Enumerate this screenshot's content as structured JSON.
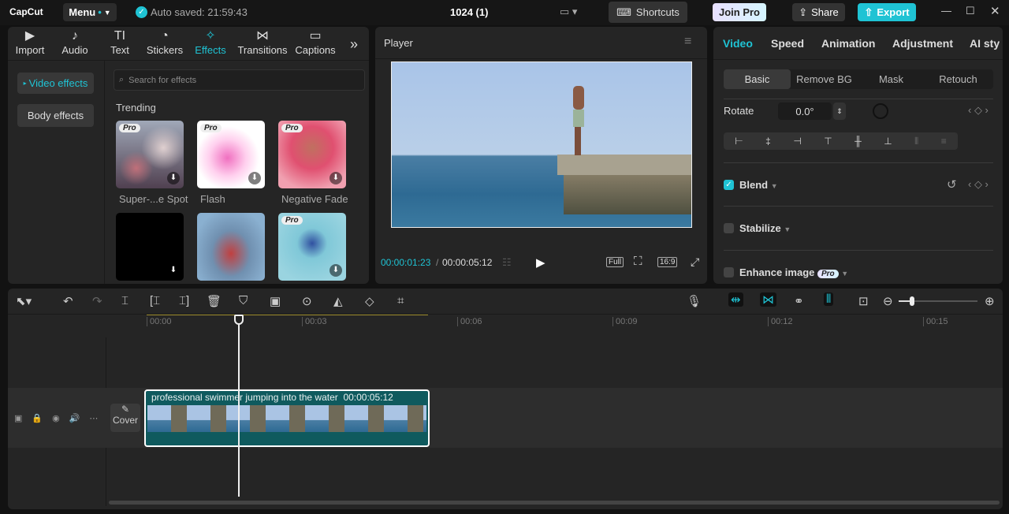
{
  "app": {
    "logo": "CapCut",
    "menu": "Menu",
    "autosave": "Auto saved: 21:59:43",
    "project": "1024 (1)",
    "shortcuts": "Shortcuts",
    "join_pro": "Join Pro",
    "share": "Share",
    "export": "Export"
  },
  "media_tabs": [
    {
      "label": "Import",
      "icon": "▶"
    },
    {
      "label": "Audio",
      "icon": "♪"
    },
    {
      "label": "Text",
      "icon": "TI"
    },
    {
      "label": "Stickers",
      "icon": "◔"
    },
    {
      "label": "Effects",
      "icon": "✧"
    },
    {
      "label": "Transitions",
      "icon": "⋈"
    },
    {
      "label": "Captions",
      "icon": "▭"
    }
  ],
  "effects": {
    "categories": [
      "Video effects",
      "Body effects"
    ],
    "search_placeholder": "Search for effects",
    "section": "Trending",
    "pro": "Pro",
    "items": [
      {
        "name": "Super-...e Spot"
      },
      {
        "name": "Flash"
      },
      {
        "name": "Negative Fade"
      }
    ]
  },
  "player": {
    "title": "Player",
    "current": "00:00:01:23",
    "total": "00:00:05:12",
    "full": "Full",
    "ratio": "16:9"
  },
  "right": {
    "tabs": [
      "Video",
      "Speed",
      "Animation",
      "Adjustment",
      "AI styli"
    ],
    "subtabs": [
      "Basic",
      "Remove BG",
      "Mask",
      "Retouch"
    ],
    "rotate_label": "Rotate",
    "rotate_value": "0.0°",
    "blend": "Blend",
    "stabilize": "Stabilize",
    "enhance": "Enhance image",
    "pro": "Pro",
    "blend_checked": true
  },
  "timeline": {
    "ticks": [
      "00:00",
      "00:03",
      "00:06",
      "00:09",
      "00:12",
      "00:15"
    ],
    "clip_title": "professional swimmer jumping into the water",
    "clip_duration": "00:00:05:12",
    "cover": "Cover"
  },
  "colors": {
    "accent": "#1fc3d4"
  }
}
